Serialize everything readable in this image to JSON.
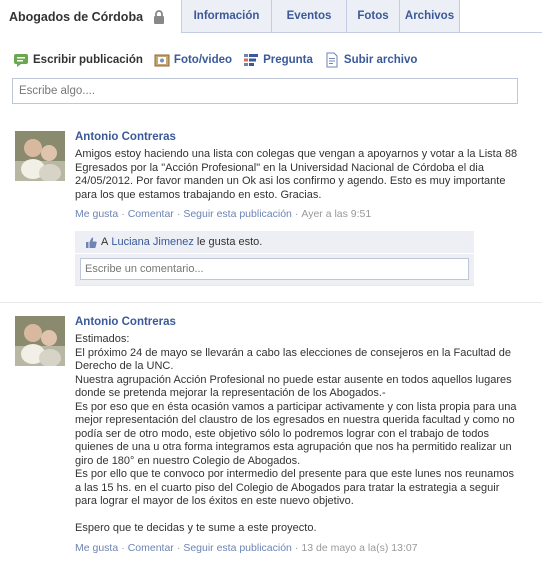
{
  "page": {
    "title": "Abogados de Córdoba",
    "tabs": [
      "Información",
      "Eventos",
      "Fotos",
      "Archivos"
    ]
  },
  "composer": {
    "links": [
      "Escribir publicación",
      "Foto/video",
      "Pregunta",
      "Subir archivo"
    ],
    "placeholder": "Escribe algo...."
  },
  "posts": [
    {
      "author": "Antonio Contreras",
      "paragraphs": [
        "Amigos estoy haciendo una lista con colegas que vengan a apoyarnos y votar a la Lista 88 Egresados por la \"Acción Profesional\" en la Universidad Nacional de Córdoba el dia 24/05/2012. Por favor manden un Ok asi los confirmo y agendo. Esto es muy importante para los que estamos trabajando en esto. Gracias."
      ],
      "actions": {
        "like": "Me gusta",
        "comment": "Comentar",
        "follow": "Seguir esta publicación",
        "time": "Ayer a las 9:51"
      },
      "likes": {
        "prefix": "A",
        "user": "Luciana Jimenez",
        "suffix": "le gusta esto."
      },
      "comment_placeholder": "Escribe un comentario..."
    },
    {
      "author": "Antonio Contreras",
      "paragraphs": [
        "Estimados:",
        "El próximo 24 de mayo se llevarán a cabo las elecciones de consejeros en la Facultad de Derecho de la UNC.",
        "Nuestra agrupación Acción Profesional no puede estar ausente en todos aquellos lugares donde se pretenda mejorar la representación de los Abogados.-",
        "Es por eso que en ésta ocasión vamos a participar activamente y con lista propia para una mejor representación del claustro de los egresados en nuestra querida facultad y como no podía ser de otro modo, este objetivo sólo lo podremos lograr con el trabajo de todos quienes de una u otra forma integramos esta agrupación que nos ha permitido realizar un giro de 180° en nuestro Colegio de Abogados.",
        "Es por ello que te convoco por intermedio del presente para que este lunes nos reunamos a las 15 hs. en el cuarto piso del Colegio de Abogados para tratar la estrategia a seguir para lograr el mayor de los éxitos en este nuevo objetivo.",
        "",
        "Espero que te decidas y te sume a este proyecto."
      ],
      "actions": {
        "like": "Me gusta",
        "comment": "Comentar",
        "follow": "Seguir esta publicación",
        "time": "13 de mayo a la(s) 13:07"
      }
    }
  ],
  "colors": {
    "link": "#3b5998",
    "tab_bg": "#eceff5",
    "feedback_bg": "#edeff4",
    "border": "#bdc7d8"
  },
  "icons": [
    "lock-icon",
    "status-icon",
    "photo-icon",
    "question-icon",
    "upload-icon",
    "like-thumb-icon",
    "avatar-photo"
  ]
}
